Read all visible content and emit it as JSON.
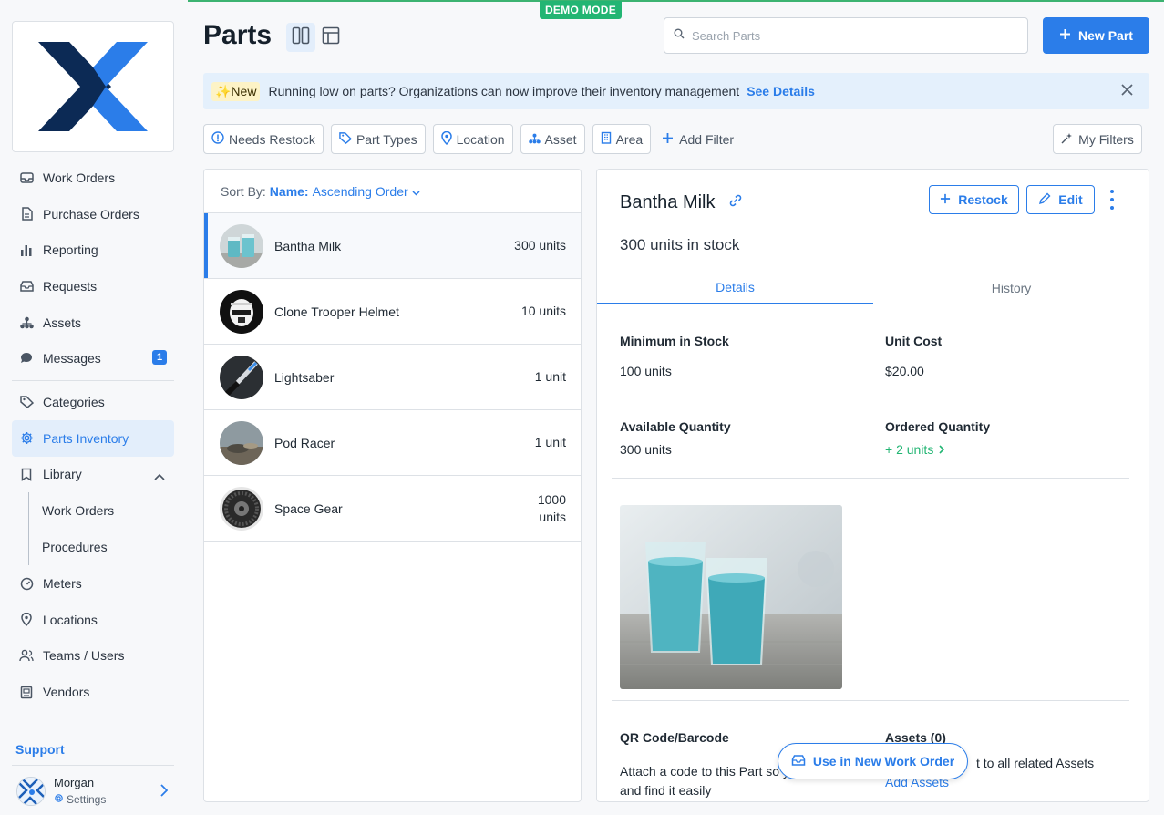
{
  "app": {
    "demo_label": "DEMO MODE",
    "page_title": "Parts"
  },
  "sidebar": {
    "items": [
      {
        "label": "Work Orders",
        "icon": "inbox-icon"
      },
      {
        "label": "Purchase Orders",
        "icon": "document-icon"
      },
      {
        "label": "Reporting",
        "icon": "bar-chart-icon"
      },
      {
        "label": "Requests",
        "icon": "tray-icon"
      },
      {
        "label": "Assets",
        "icon": "hierarchy-icon"
      },
      {
        "label": "Messages",
        "icon": "chat-icon",
        "badge": "1"
      }
    ],
    "items2": [
      {
        "label": "Categories",
        "icon": "tag-icon"
      },
      {
        "label": "Parts Inventory",
        "icon": "gear-icon"
      },
      {
        "label": "Library",
        "icon": "bookmark-icon"
      }
    ],
    "library_sub": [
      {
        "label": "Work Orders"
      },
      {
        "label": "Procedures"
      }
    ],
    "items3": [
      {
        "label": "Meters",
        "icon": "gauge-icon"
      },
      {
        "label": "Locations",
        "icon": "pin-icon"
      },
      {
        "label": "Teams / Users",
        "icon": "users-icon"
      },
      {
        "label": "Vendors",
        "icon": "vendor-icon"
      }
    ],
    "support_label": "Support",
    "user": {
      "name": "Morgan",
      "settings_label": "Settings"
    }
  },
  "header": {
    "search_placeholder": "Search Parts",
    "new_part_label": "New Part"
  },
  "banner": {
    "tag": "✨New",
    "text": "Running low on parts? Organizations can now improve their inventory management",
    "link": "See Details"
  },
  "filters": {
    "items": [
      "Needs Restock",
      "Part Types",
      "Location",
      "Asset",
      "Area"
    ],
    "add_filter": "Add Filter",
    "my_filters": "My Filters"
  },
  "list": {
    "sort_prefix": "Sort By:",
    "sort_field": "Name:",
    "sort_order": "Ascending Order",
    "rows": [
      {
        "name": "Bantha Milk",
        "qty": "300 units"
      },
      {
        "name": "Clone Trooper Helmet",
        "qty": "10 units"
      },
      {
        "name": "Lightsaber",
        "qty": "1 unit"
      },
      {
        "name": "Pod Racer",
        "qty": "1 unit"
      },
      {
        "name": "Space Gear",
        "qty_line1": "1000",
        "qty_line2": "units"
      }
    ]
  },
  "detail": {
    "title": "Bantha Milk",
    "stock": "300 units in stock",
    "restock_label": "Restock",
    "edit_label": "Edit",
    "tabs": [
      "Details",
      "History"
    ],
    "min_stock_label": "Minimum in Stock",
    "min_stock_value": "100 units",
    "unit_cost_label": "Unit Cost",
    "unit_cost_value": "$20.00",
    "available_label": "Available Quantity",
    "available_value": "300 units",
    "ordered_label": "Ordered Quantity",
    "ordered_value": "+ 2 units",
    "qr_label": "QR Code/Barcode",
    "qr_text_1": "Attach a code to this Part so y",
    "qr_text_2": "and find it easily",
    "assets_label": "Assets (0)",
    "assets_text": "t to all related Assets",
    "add_assets": "Add Assets",
    "use_button": "Use in New Work Order"
  },
  "colors": {
    "accent": "#2b7de9",
    "demo": "#22b573",
    "banner": "#e4f0fc"
  }
}
